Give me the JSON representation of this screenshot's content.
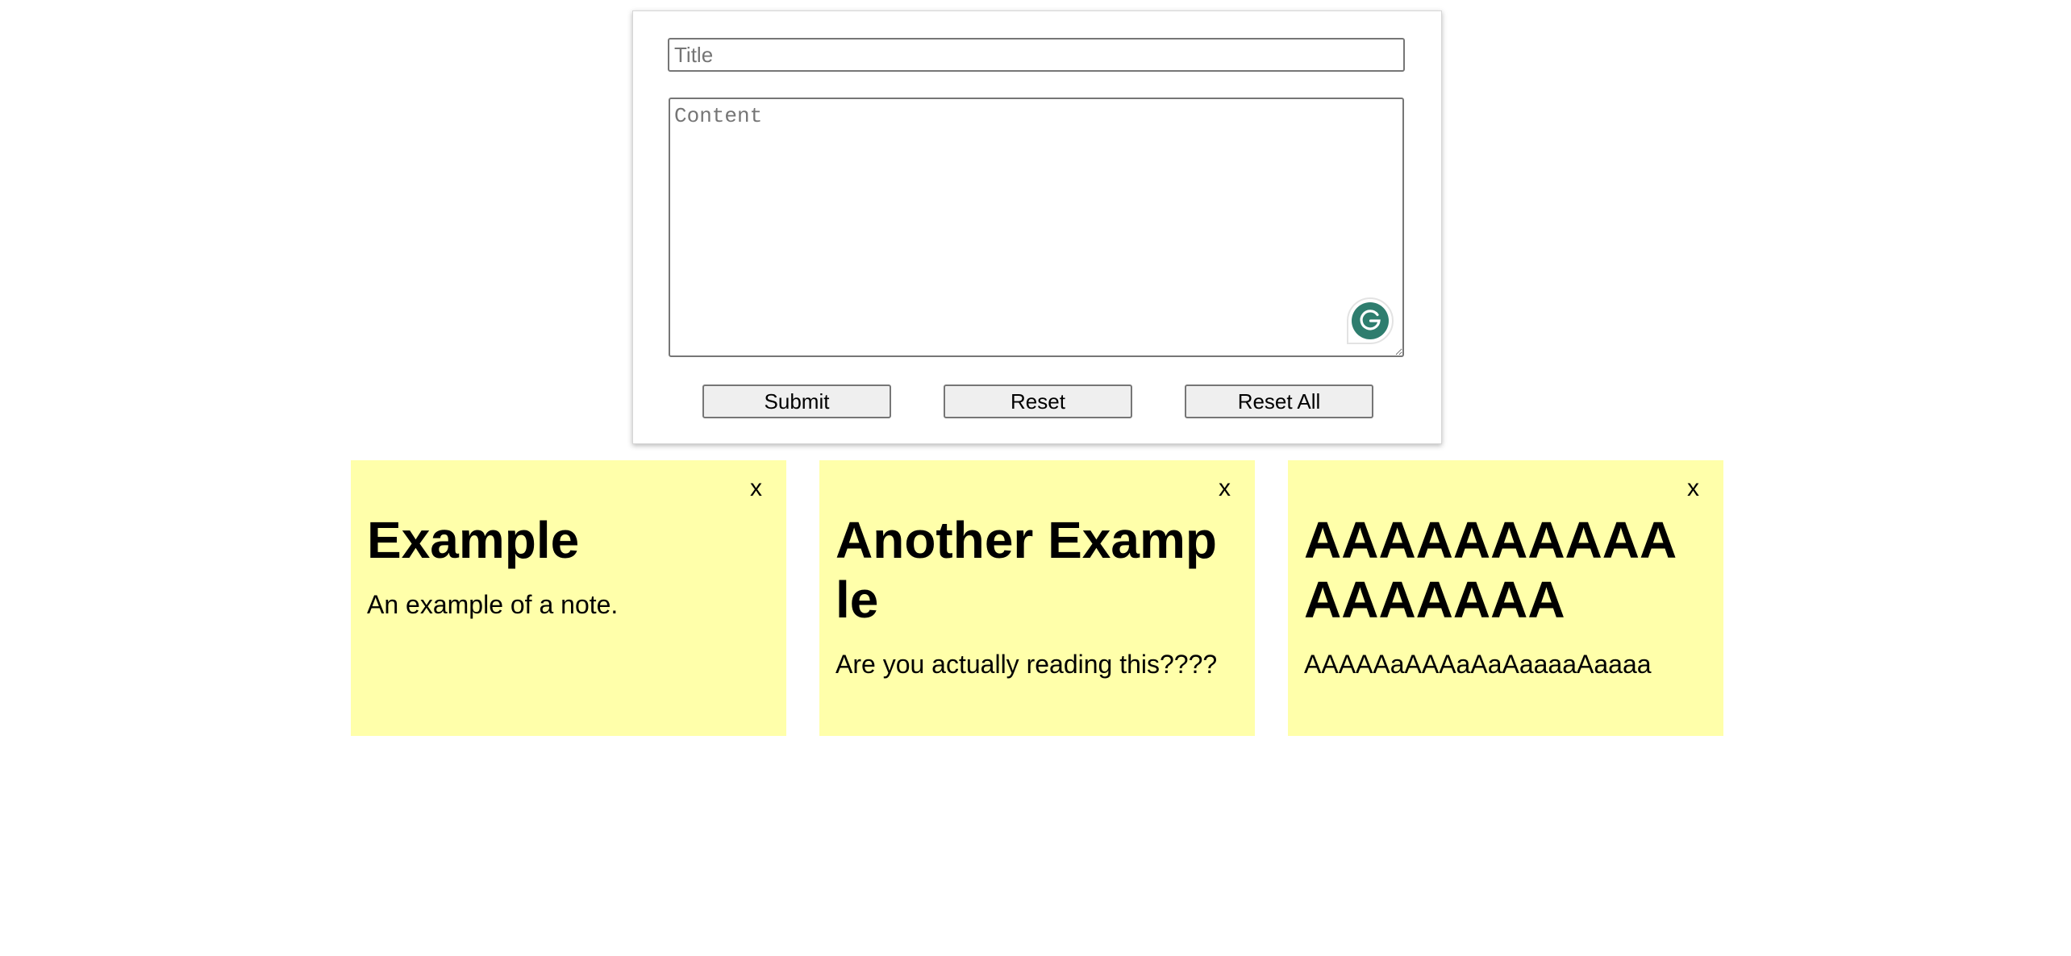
{
  "form": {
    "title_placeholder": "Title",
    "title_value": "",
    "content_placeholder": "Content",
    "content_value": "",
    "submit_label": "Submit",
    "reset_label": "Reset",
    "reset_all_label": "Reset All",
    "grammarly_icon": "grammarly-icon",
    "grammarly_color": "#2e7d6e"
  },
  "notes": [
    {
      "close_label": "x",
      "title": "Example",
      "body": "An example of a note."
    },
    {
      "close_label": "x",
      "title": "Another Example",
      "body": "Are you actually reading this????"
    },
    {
      "close_label": "x",
      "title": "AAAAAAAAAAAAAAAAA",
      "body": "AAAAAaAAAaAaAaaaaAaaaa"
    }
  ],
  "colors": {
    "note_background": "#ffffaa",
    "button_background": "#efefef",
    "input_border": "#767676"
  }
}
